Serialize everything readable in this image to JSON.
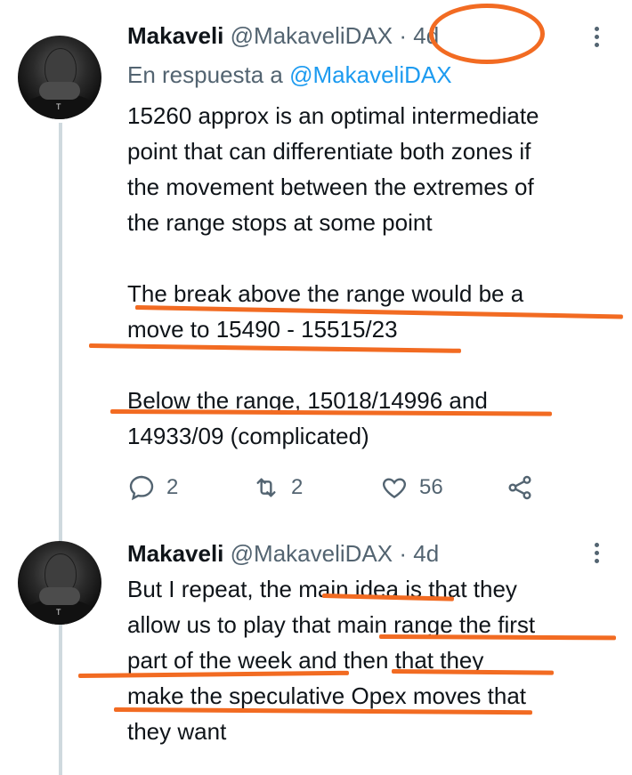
{
  "thread_line_color": "#cfd9de",
  "annotation_color": "#f26b22",
  "tweets": [
    {
      "author": "Makaveli",
      "handle": "@MakaveliDAX",
      "separator": "·",
      "time": "4d",
      "reply_prefix": "En respuesta a",
      "reply_handle": "@MakaveliDAX",
      "paragraphs": [
        [
          "15260 approx is an optimal intermediate",
          "point that can differentiate both zones if",
          "the movement between the extremes of",
          "the range stops at some point"
        ],
        [
          "The break above the range would be a",
          "move to 15490 - 15515/23"
        ],
        [
          "Below the range, 15018/14996 and",
          "14933/09 (complicated)"
        ]
      ],
      "replies": "2",
      "retweets": "2",
      "likes": "56"
    },
    {
      "author": "Makaveli",
      "handle": "@MakaveliDAX",
      "separator": "·",
      "time": "4d",
      "paragraphs": [
        [
          "But I repeat, the main idea is that they",
          "allow us to play that main range the first",
          "part of the week and then that they",
          "make the speculative Opex moves that",
          "they want"
        ]
      ]
    }
  ]
}
